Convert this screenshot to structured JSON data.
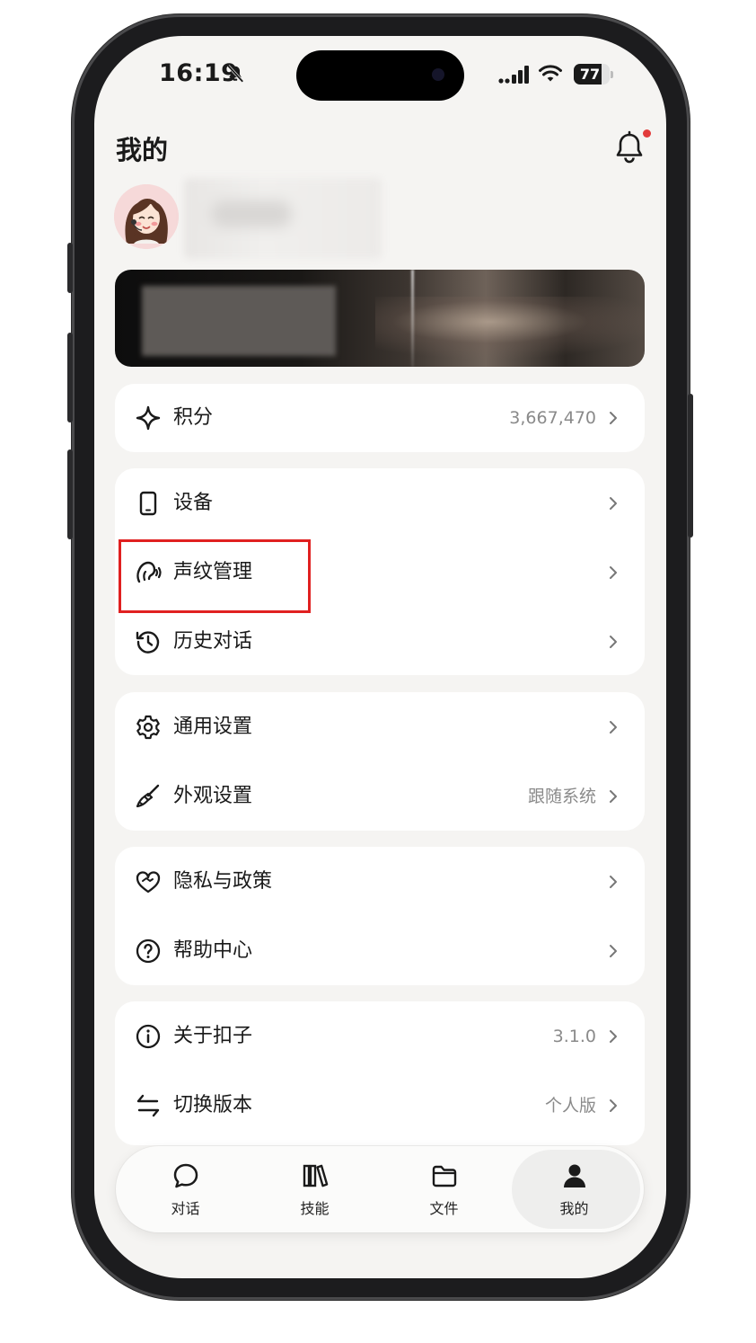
{
  "status_bar": {
    "time": "16:19",
    "battery": "77"
  },
  "header": {
    "title": "我的"
  },
  "menu": {
    "points": {
      "label": "积分",
      "value": "3,667,470"
    },
    "devices": {
      "label": "设备"
    },
    "voiceprint": {
      "label": "声纹管理"
    },
    "history": {
      "label": "历史对话"
    },
    "general": {
      "label": "通用设置"
    },
    "appearance": {
      "label": "外观设置",
      "value": "跟随系统"
    },
    "privacy": {
      "label": "隐私与政策"
    },
    "help": {
      "label": "帮助中心"
    },
    "about": {
      "label": "关于扣子",
      "value": "3.1.0"
    },
    "switch": {
      "label": "切换版本",
      "value": "个人版"
    }
  },
  "tabs": [
    {
      "label": "对话",
      "icon": "chat-bubble-icon"
    },
    {
      "label": "技能",
      "icon": "books-icon"
    },
    {
      "label": "文件",
      "icon": "folder-icon"
    },
    {
      "label": "我的",
      "icon": "person-icon",
      "active": true
    }
  ],
  "colors": {
    "notification_dot": "#e23b3b",
    "highlight_box": "#e02020",
    "screen_bg": "#f5f4f2"
  }
}
